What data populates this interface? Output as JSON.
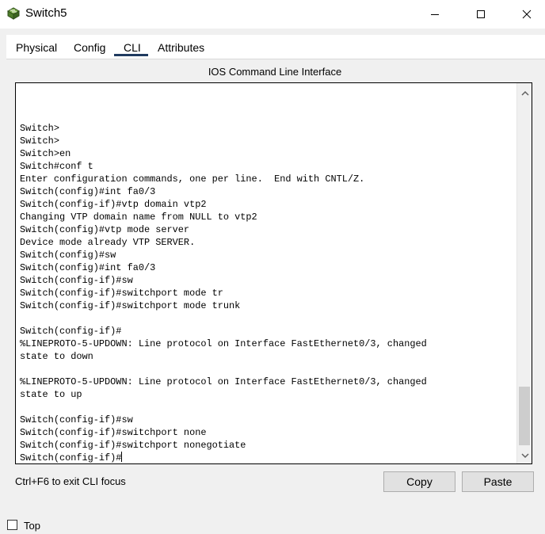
{
  "window": {
    "title": "Switch5",
    "icons": {
      "app": "switch-app-icon",
      "minimize": "minimize-icon",
      "maximize": "maximize-icon",
      "close": "close-icon"
    }
  },
  "tabs": [
    {
      "label": "Physical",
      "active": false
    },
    {
      "label": "Config",
      "active": false
    },
    {
      "label": "CLI",
      "active": true
    },
    {
      "label": "Attributes",
      "active": false
    }
  ],
  "cli": {
    "heading": "IOS Command Line Interface",
    "lines": [
      "Switch>",
      "Switch>",
      "Switch>en",
      "Switch#conf t",
      "Enter configuration commands, one per line.  End with CNTL/Z.",
      "Switch(config)#int fa0/3",
      "Switch(config-if)#vtp domain vtp2",
      "Changing VTP domain name from NULL to vtp2",
      "Switch(config)#vtp mode server",
      "Device mode already VTP SERVER.",
      "Switch(config)#sw",
      "Switch(config)#int fa0/3",
      "Switch(config-if)#sw",
      "Switch(config-if)#switchport mode tr",
      "Switch(config-if)#switchport mode trunk",
      "",
      "Switch(config-if)#",
      "%LINEPROTO-5-UPDOWN: Line protocol on Interface FastEthernet0/3, changed",
      "state to down",
      "",
      "%LINEPROTO-5-UPDOWN: Line protocol on Interface FastEthernet0/3, changed",
      "state to up",
      "",
      "Switch(config-if)#sw",
      "Switch(config-if)#switchport none",
      "Switch(config-if)#switchport nonegotiate",
      "Switch(config-if)#"
    ],
    "hint": "Ctrl+F6 to exit CLI focus",
    "copy_label": "Copy",
    "paste_label": "Paste"
  },
  "footer": {
    "top_label": "Top",
    "top_checked": false
  }
}
